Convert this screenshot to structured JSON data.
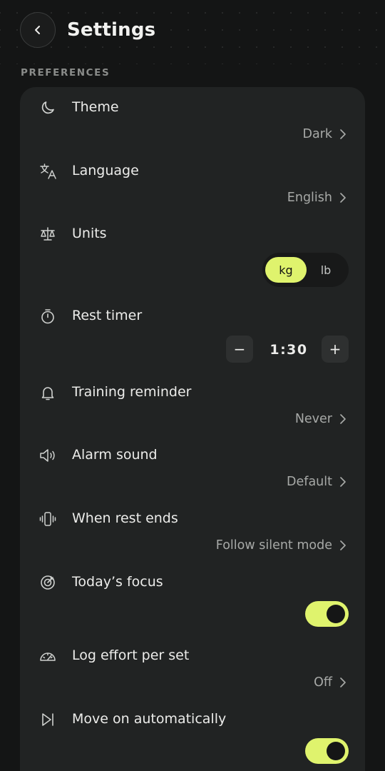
{
  "header": {
    "title": "Settings",
    "back_icon": "chevron-left-icon"
  },
  "section": {
    "label": "PREFERENCES"
  },
  "colors": {
    "accent": "#dff36d",
    "background": "#141515",
    "card": "#212323"
  },
  "rows": {
    "theme": {
      "label": "Theme",
      "value": "Dark",
      "icon": "moon-icon"
    },
    "language": {
      "label": "Language",
      "value": "English",
      "icon": "translate-icon"
    },
    "units": {
      "label": "Units",
      "icon": "scale-icon",
      "options": [
        "kg",
        "lb"
      ],
      "selected": "kg"
    },
    "rest_timer": {
      "label": "Rest timer",
      "icon": "stopwatch-icon",
      "value": "1:30",
      "decrement": "−",
      "increment": "+"
    },
    "training_reminder": {
      "label": "Training reminder",
      "value": "Never",
      "icon": "bell-icon"
    },
    "alarm_sound": {
      "label": "Alarm sound",
      "value": "Default",
      "icon": "speaker-icon"
    },
    "when_rest_ends": {
      "label": "When rest ends",
      "value": "Follow silent mode",
      "icon": "vibrate-icon"
    },
    "todays_focus": {
      "label": "Today’s focus",
      "icon": "target-icon",
      "enabled": true
    },
    "log_effort": {
      "label": "Log effort per set",
      "value": "Off",
      "icon": "gauge-icon"
    },
    "move_on": {
      "label": "Move on automatically",
      "icon": "skip-next-icon",
      "enabled": true
    }
  }
}
